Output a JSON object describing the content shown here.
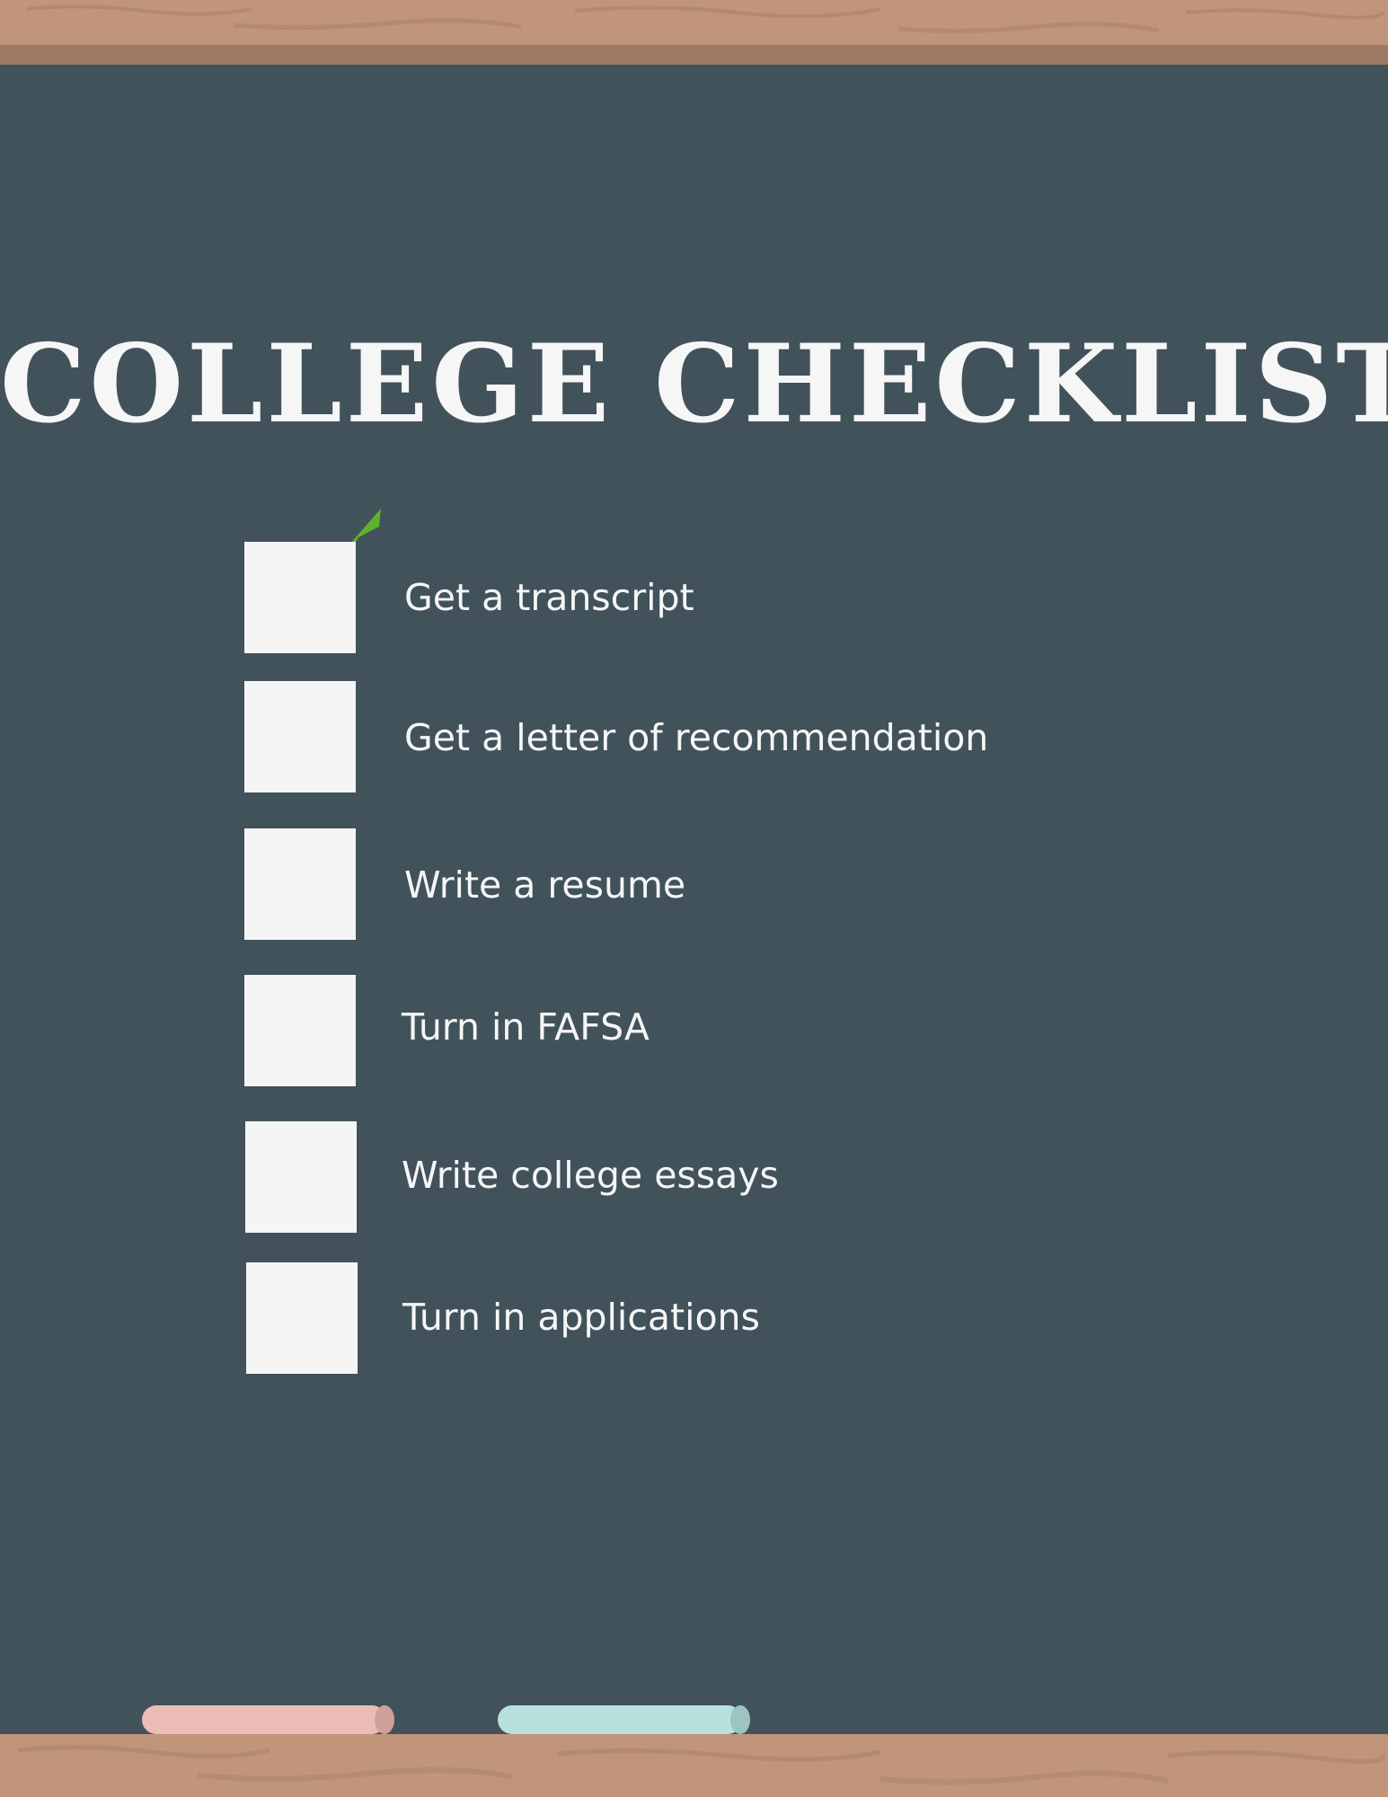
{
  "title": "COLLEGE CHECKLIST",
  "items": [
    {
      "label": "Get a transcript",
      "checked": true
    },
    {
      "label": "Get a letter of recommendation",
      "checked": false
    },
    {
      "label": "Write a resume",
      "checked": false
    },
    {
      "label": "Turn in FAFSA",
      "checked": false
    },
    {
      "label": "Write college essays",
      "checked": false
    },
    {
      "label": "Turn in applications",
      "checked": false
    }
  ],
  "colors": {
    "board": "#41525b",
    "wood": "#c0957a",
    "wood_dark": "#9d7a63",
    "text": "#f6f6f6",
    "checkbox": "#f5f5f5",
    "check": "#5fb12c",
    "chalk_pink": "#ebbcb7",
    "chalk_blue": "#b8e0df"
  },
  "icons": {
    "check": "checkmark-icon",
    "chalk_pink": "pink-chalk-icon",
    "chalk_blue": "blue-chalk-icon"
  }
}
